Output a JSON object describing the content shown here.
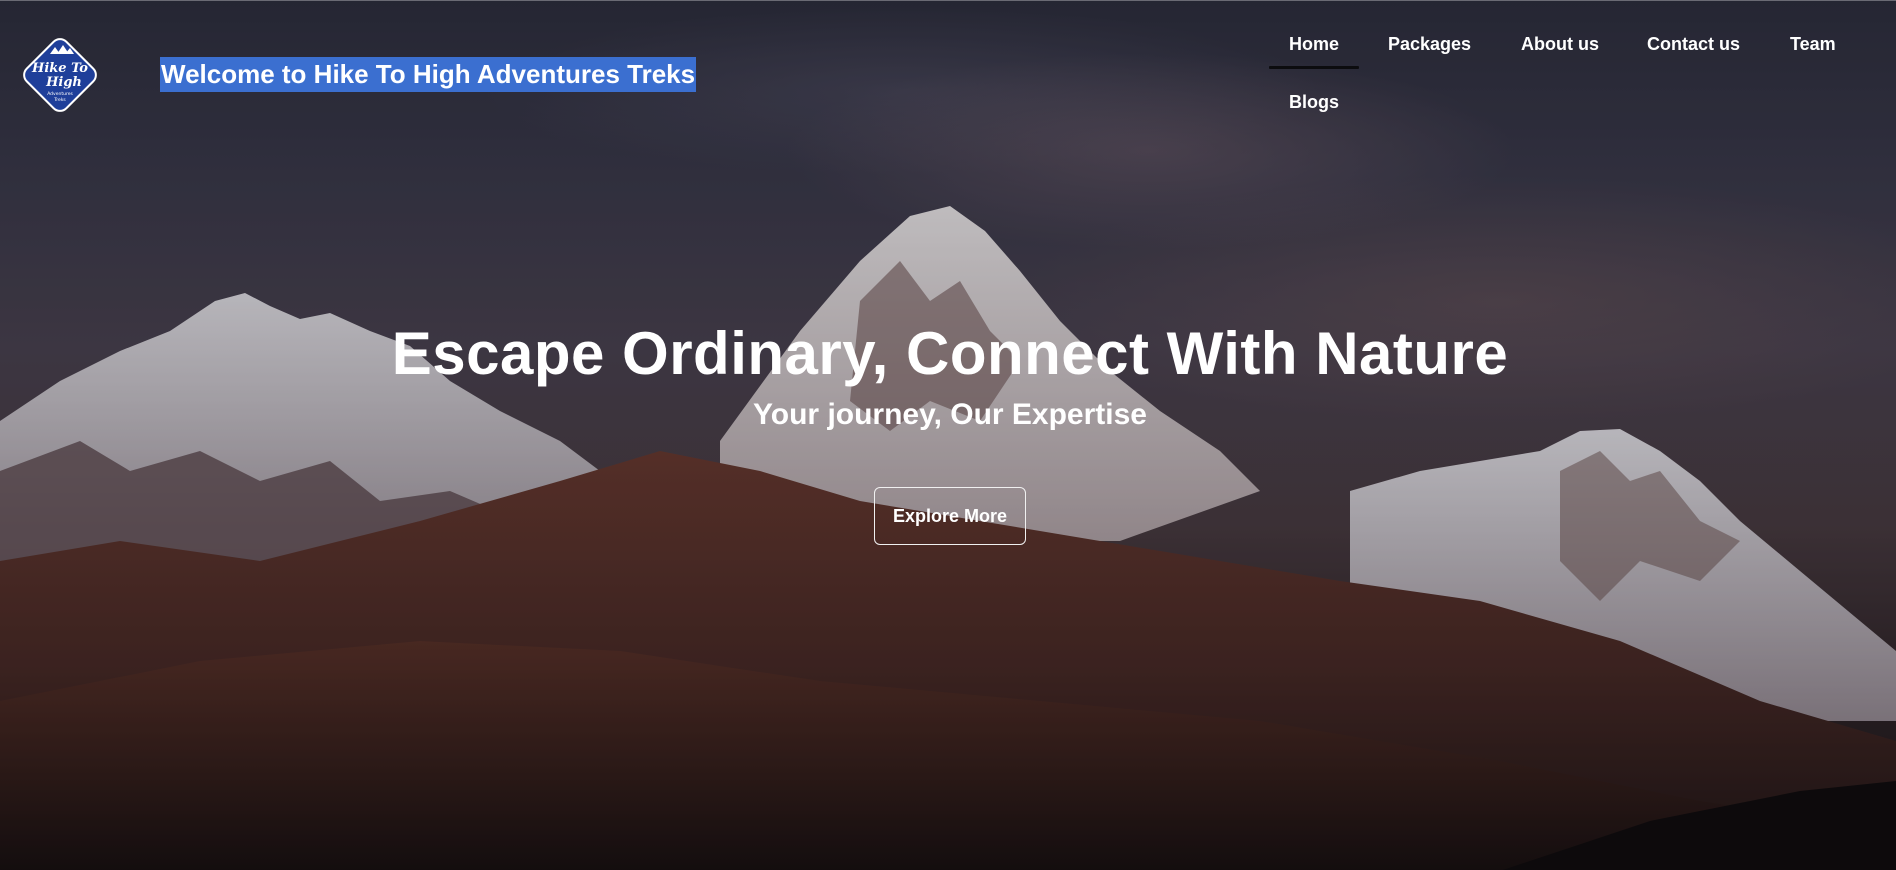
{
  "header": {
    "logo": {
      "line1": "Hike To",
      "line2": "High",
      "line3": "Adventures",
      "line4": "Treks",
      "color": "#1f3f9a"
    },
    "site_title": "Welcome to Hike To High Adventures Treks",
    "selection_color": "#3b6fd0"
  },
  "nav": {
    "items": [
      {
        "label": "Home",
        "active": true
      },
      {
        "label": "Packages",
        "active": false
      },
      {
        "label": "About us",
        "active": false
      },
      {
        "label": "Contact us",
        "active": false
      },
      {
        "label": "Team",
        "active": false
      },
      {
        "label": "Blogs",
        "active": false
      }
    ]
  },
  "hero": {
    "headline": "Escape Ordinary, Connect With Nature",
    "subheadline": "Your journey, Our Expertise",
    "cta_label": "Explore More",
    "background": "snow-capped-mountains-at-dusk"
  }
}
